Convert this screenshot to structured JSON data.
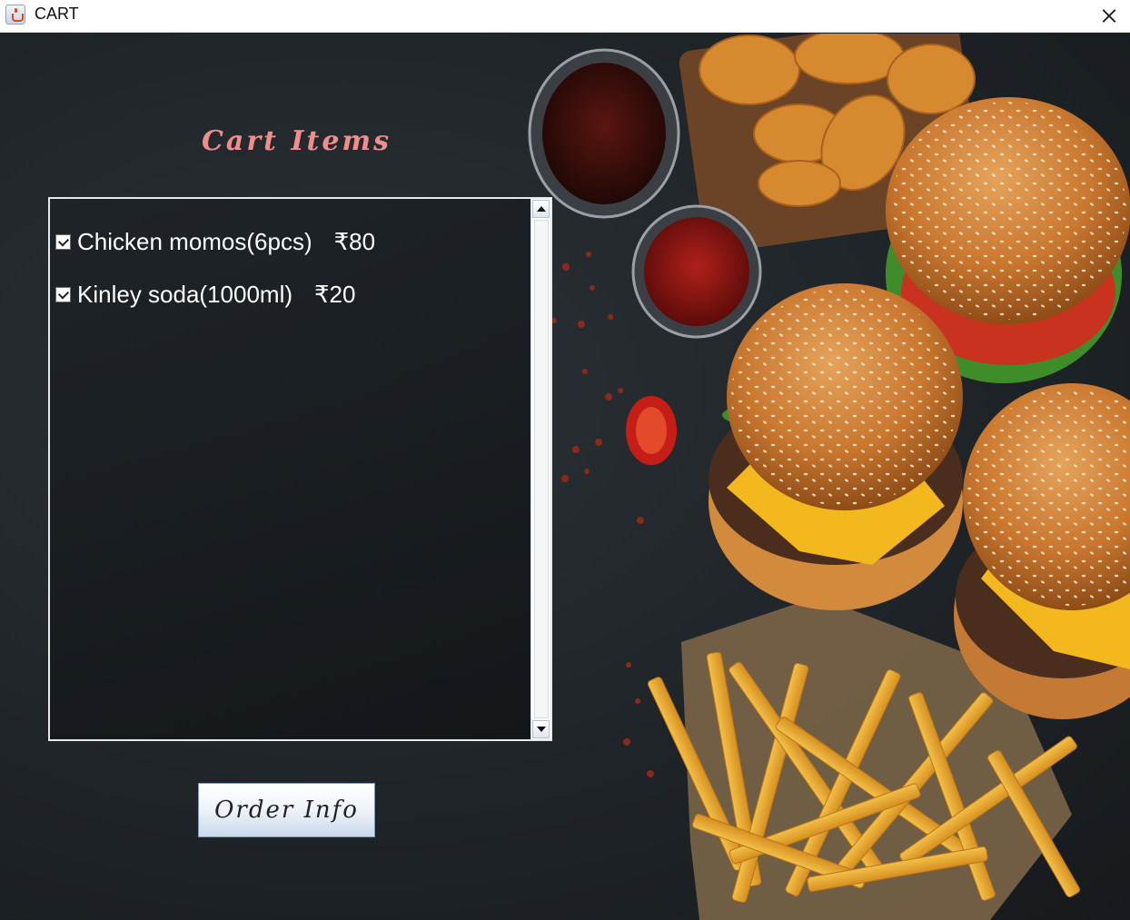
{
  "window": {
    "title": "CART",
    "icon": "java-cup-icon",
    "close_icon": "close-icon"
  },
  "cart": {
    "heading": "Cart Items",
    "items": [
      {
        "name": "Chicken momos(6pcs)",
        "price": "₹80",
        "checked": true
      },
      {
        "name": "Kinley soda(1000ml)",
        "price": "₹20",
        "checked": true
      }
    ]
  },
  "actions": {
    "order_info_label": "Order Info"
  },
  "colors": {
    "heading": "#f08d8d",
    "background": "#1f2428",
    "text": "#ffffff"
  }
}
